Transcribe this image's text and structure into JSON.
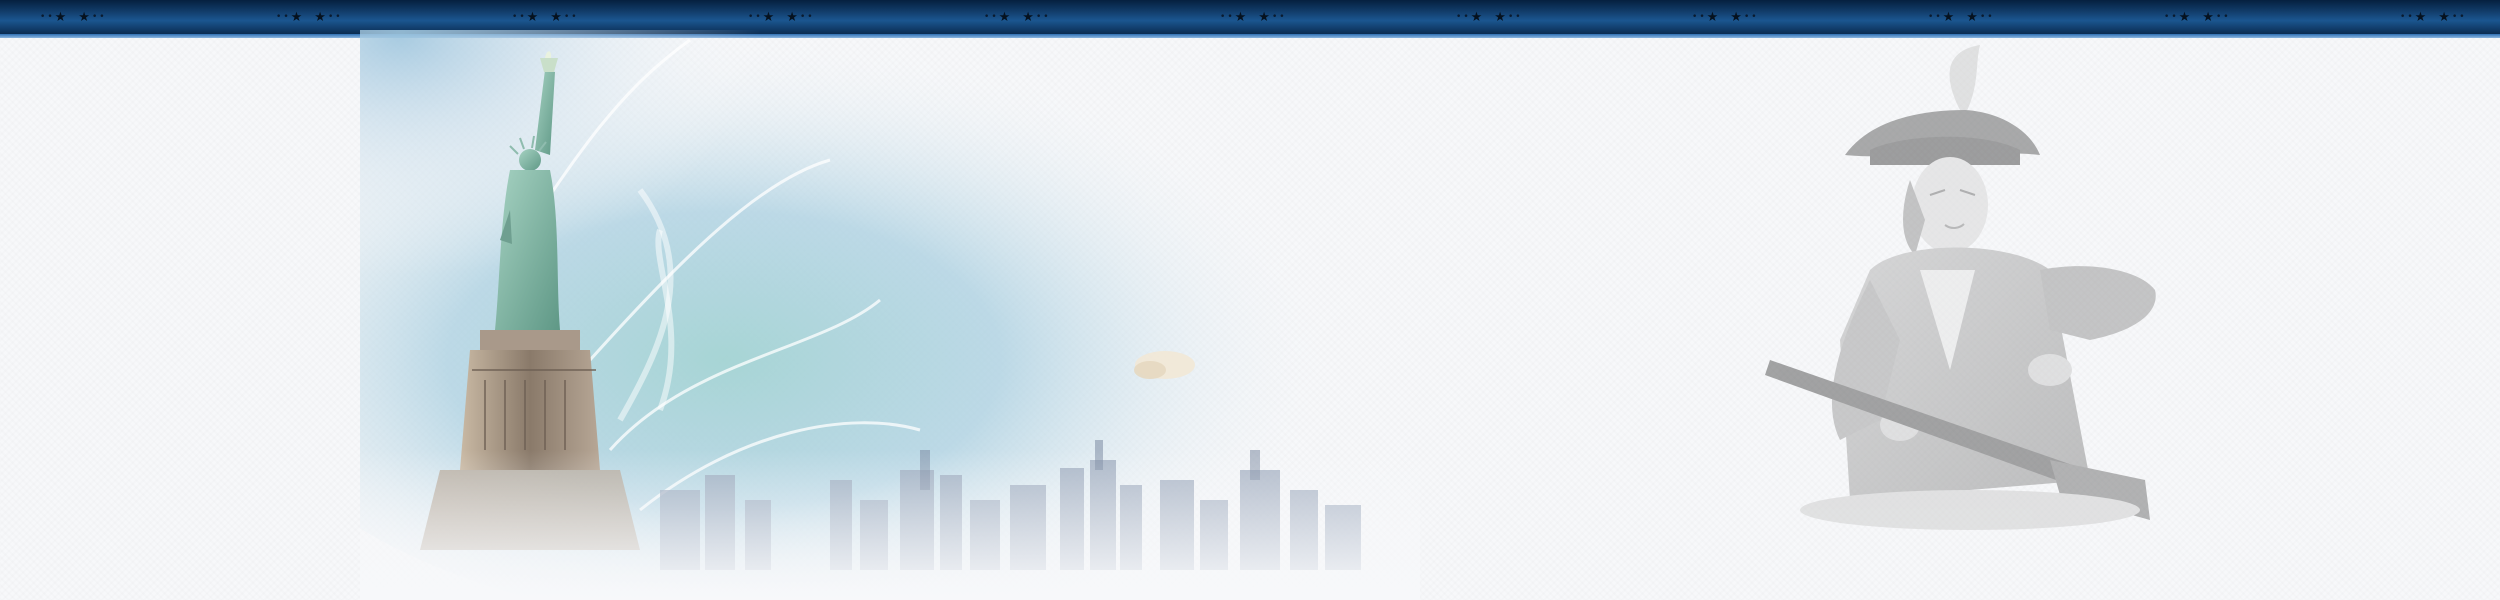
{
  "page": {
    "background_color": "#f7f8fa",
    "band_color_dark": "#05203f",
    "band_color_mid": "#1b5690",
    "band_accent": "#8cb6e0"
  },
  "top_band": {
    "ornament": "dot-dot-star-star-dot-dot",
    "repeat_count": 11
  },
  "artwork": {
    "left_scene": "statue-of-liberty-skyline",
    "right_scene": "minuteman-engraving",
    "sky_color": "#a9cfe0",
    "statue_color": "#7fb0a2",
    "skyline_color": "#9aa7bb"
  }
}
